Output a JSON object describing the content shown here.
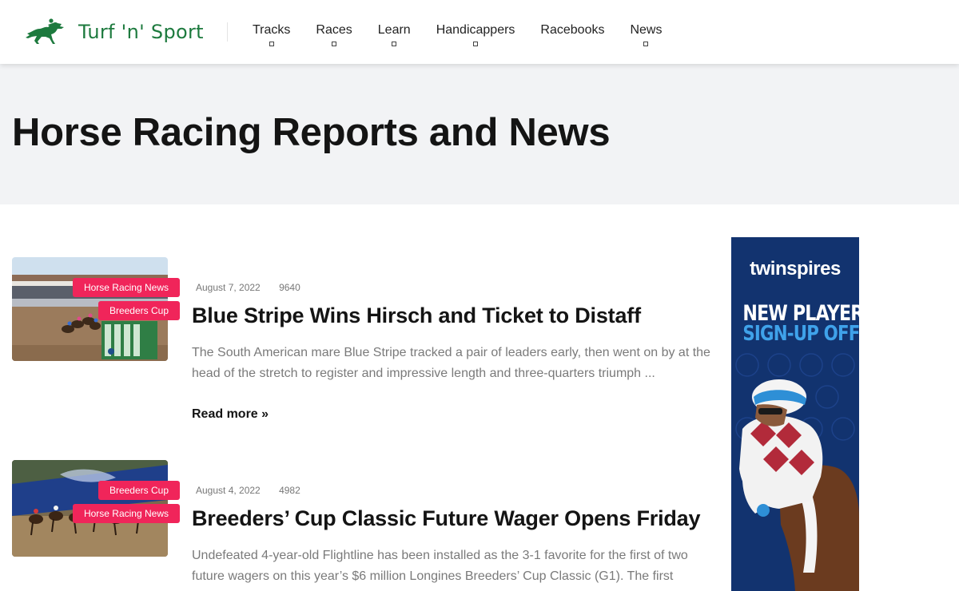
{
  "header": {
    "logo_text": "Turf 'n' Sport",
    "nav": [
      {
        "label": "Tracks",
        "has_dropdown": true
      },
      {
        "label": "Races",
        "has_dropdown": true
      },
      {
        "label": "Learn",
        "has_dropdown": true
      },
      {
        "label": "Handicappers",
        "has_dropdown": true
      },
      {
        "label": "Racebooks",
        "has_dropdown": false
      },
      {
        "label": "News",
        "has_dropdown": true
      }
    ]
  },
  "hero": {
    "title": "Horse Racing Reports and News"
  },
  "posts": [
    {
      "tags": [
        "Horse Racing News",
        "Breeders Cup"
      ],
      "date": "August 7, 2022",
      "views": "9640",
      "title": "Blue Stripe Wins Hirsch and Ticket to Distaff",
      "excerpt": "The South American mare Blue Stripe tracked a pair of leaders early, then went on by at the head of the stretch to register and impressive length and three-quarters triumph ...",
      "read_more": "Read more »"
    },
    {
      "tags": [
        "Breeders Cup",
        "Horse Racing News"
      ],
      "date": "August 4, 2022",
      "views": "4982",
      "title": "Breeders’ Cup Classic Future Wager Opens Friday",
      "excerpt": "Undefeated 4-year-old Flightline has been installed as the 3-1 favorite for the first of two future wagers on this year’s $6 million Longines Breeders’ Cup Classic (G1). The first"
    }
  ],
  "ad": {
    "brand": "twinspires",
    "headline_1": "NEW PLAYER",
    "headline_2": "SIGN-UP OFFER"
  },
  "colors": {
    "brand_green": "#1d7a3e",
    "tag_pink": "#f0255a",
    "hero_bg": "#f2f3f5",
    "ad_navy": "#12336f",
    "ad_blue": "#3fa2ea"
  },
  "icons": {
    "logo": "horse-and-jockey-icon",
    "dropdown": "dropdown-caret-icon"
  }
}
